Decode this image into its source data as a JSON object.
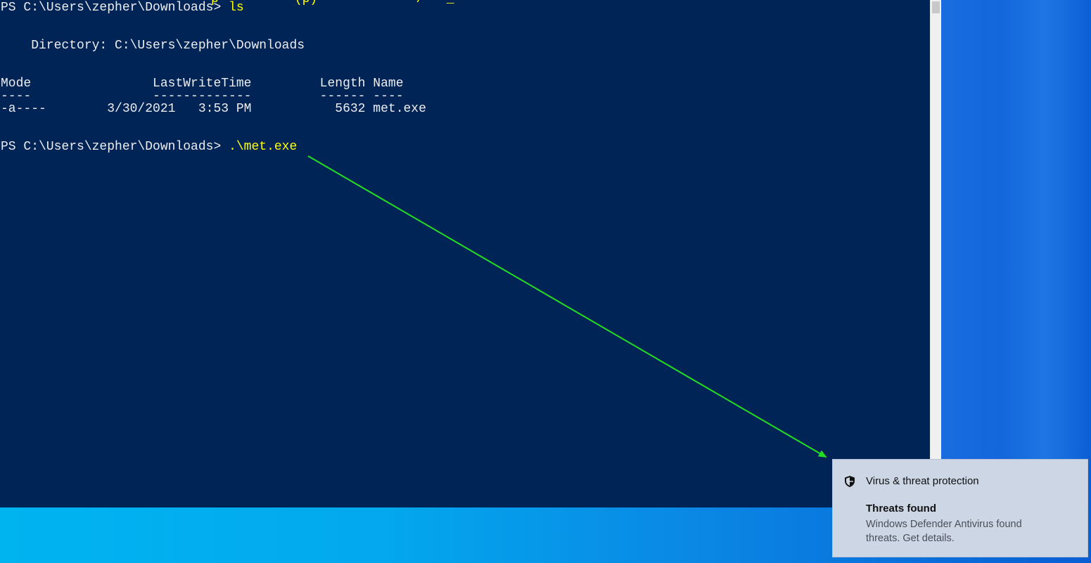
{
  "console": {
    "cut_top_text": "p          (p)             /   _",
    "line1_prompt": "PS C:\\Users\\zepher\\Downloads> ",
    "line1_cmd": "ls",
    "dir_line": "    Directory: C:\\Users\\zepher\\Downloads",
    "header": "Mode                LastWriteTime         Length Name",
    "separator": "----                -------------         ------ ----",
    "row1": "-a----        3/30/2021   3:53 PM           5632 met.exe",
    "line2_prompt": "PS C:\\Users\\zepher\\Downloads> ",
    "line2_cmd": ".\\met.exe"
  },
  "toast": {
    "app_name": "Virus & threat protection",
    "title": "Threats found",
    "body": "Windows Defender Antivirus found threats. Get details.",
    "icon": "shield-icon"
  },
  "colors": {
    "console_bg": "#012456",
    "command_text": "#ffff00",
    "arrow": "#22dd22"
  }
}
